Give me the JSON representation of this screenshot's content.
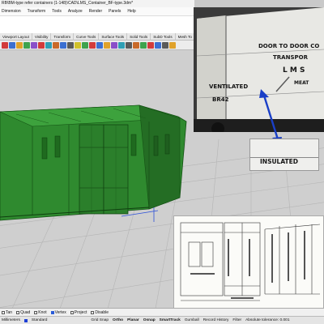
{
  "window": {
    "title_path": "RB\\BM-type refer containers (1-148)\\CAD\\LMS_Container_BF-type.3dm*"
  },
  "menu": [
    "Dimension",
    "Transform",
    "Tools",
    "Analyze",
    "Render",
    "Panels",
    "Help"
  ],
  "tabs": [
    "Viewport Layout",
    "Visibility",
    "Transform",
    "Curve Tools",
    "Surface Tools",
    "Solid Tools",
    "SubD Tools",
    "Mesh To"
  ],
  "osnap": {
    "items": [
      {
        "label": "Tan",
        "checked": false
      },
      {
        "label": "Quad",
        "checked": false
      },
      {
        "label": "Knot",
        "checked": false
      },
      {
        "label": "Vertex",
        "checked": true
      },
      {
        "label": "Project",
        "checked": false
      },
      {
        "label": "Disable",
        "checked": false
      }
    ]
  },
  "status": {
    "units": "Millimeters",
    "layer": "Standard",
    "items": [
      "Grid Snap",
      "Ortho",
      "Planar",
      "Osnap",
      "SmartTrack",
      "Gumball",
      "Record History",
      "Filter"
    ],
    "tolerance": "Absolute tolerance: 0.001"
  },
  "photo": {
    "stencil_1": "DOOR TO DOOR CO",
    "stencil_2": "TRANSPOR",
    "stencil_3": "L M S",
    "stencil_4": "MEAT",
    "stencil_5": "VENTILATED",
    "stencil_6": "BR42",
    "inset_text": "INSULATED",
    "arrow_color": "#1a3fc7"
  },
  "colors": {
    "model_green": "#2f8a2f",
    "model_dark": "#145214",
    "viewport_bg": "#cfcfcf",
    "grid_line": "#b7b7b7",
    "axis_blue": "#2b4fd9"
  }
}
